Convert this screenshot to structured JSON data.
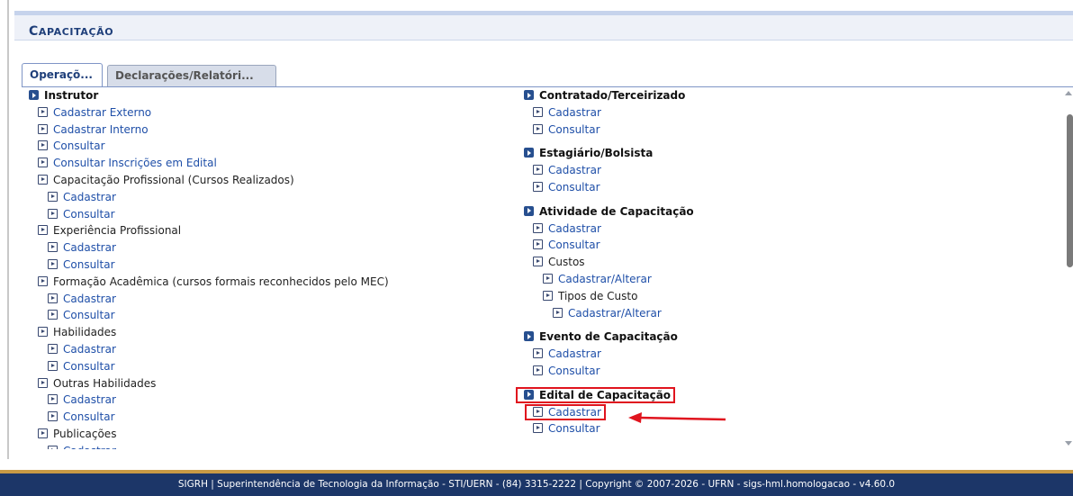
{
  "page": {
    "title_first": "C",
    "title_rest": "apacitação"
  },
  "tabs": [
    {
      "label": "Operaçõ..."
    },
    {
      "label": "Declarações/Relatóri..."
    }
  ],
  "left_menu": [
    {
      "type": "header",
      "level": 0,
      "label": "Instrutor"
    },
    {
      "type": "link",
      "level": 1,
      "label": "Cadastrar Externo"
    },
    {
      "type": "link",
      "level": 1,
      "label": "Cadastrar Interno"
    },
    {
      "type": "link",
      "level": 1,
      "label": "Consultar"
    },
    {
      "type": "link",
      "level": 1,
      "label": "Consultar Inscrições em Edital"
    },
    {
      "type": "plain",
      "level": 1,
      "label": "Capacitação Profissional (Cursos Realizados)"
    },
    {
      "type": "link",
      "level": 2,
      "label": "Cadastrar"
    },
    {
      "type": "link",
      "level": 2,
      "label": "Consultar"
    },
    {
      "type": "plain",
      "level": 1,
      "label": "Experiência Profissional"
    },
    {
      "type": "link",
      "level": 2,
      "label": "Cadastrar"
    },
    {
      "type": "link",
      "level": 2,
      "label": "Consultar"
    },
    {
      "type": "plain",
      "level": 1,
      "label": "Formação Acadêmica (cursos formais reconhecidos pelo MEC)"
    },
    {
      "type": "link",
      "level": 2,
      "label": "Cadastrar"
    },
    {
      "type": "link",
      "level": 2,
      "label": "Consultar"
    },
    {
      "type": "plain",
      "level": 1,
      "label": "Habilidades"
    },
    {
      "type": "link",
      "level": 2,
      "label": "Cadastrar"
    },
    {
      "type": "link",
      "level": 2,
      "label": "Consultar"
    },
    {
      "type": "plain",
      "level": 1,
      "label": "Outras Habilidades"
    },
    {
      "type": "link",
      "level": 2,
      "label": "Cadastrar"
    },
    {
      "type": "link",
      "level": 2,
      "label": "Consultar"
    },
    {
      "type": "plain",
      "level": 1,
      "label": "Publicações"
    },
    {
      "type": "link",
      "level": 2,
      "label": "Cadastrar"
    }
  ],
  "right_menu": [
    {
      "type": "header",
      "level": 0,
      "label": "Contratado/Terceirizado"
    },
    {
      "type": "link",
      "level": 1,
      "label": "Cadastrar"
    },
    {
      "type": "link",
      "level": 1,
      "label": "Consultar"
    },
    {
      "type": "gap"
    },
    {
      "type": "header",
      "level": 0,
      "label": "Estagiário/Bolsista"
    },
    {
      "type": "link",
      "level": 1,
      "label": "Cadastrar"
    },
    {
      "type": "link",
      "level": 1,
      "label": "Consultar"
    },
    {
      "type": "gap"
    },
    {
      "type": "header",
      "level": 0,
      "label": "Atividade de Capacitação"
    },
    {
      "type": "link",
      "level": 1,
      "label": "Cadastrar"
    },
    {
      "type": "link",
      "level": 1,
      "label": "Consultar"
    },
    {
      "type": "plain",
      "level": 1,
      "label": "Custos"
    },
    {
      "type": "link",
      "level": 2,
      "label": "Cadastrar/Alterar"
    },
    {
      "type": "plain",
      "level": 2,
      "label": "Tipos de Custo"
    },
    {
      "type": "link",
      "level": 3,
      "label": "Cadastrar/Alterar"
    },
    {
      "type": "gap"
    },
    {
      "type": "header",
      "level": 0,
      "label": "Evento de Capacitação"
    },
    {
      "type": "link",
      "level": 1,
      "label": "Cadastrar"
    },
    {
      "type": "link",
      "level": 1,
      "label": "Consultar"
    },
    {
      "type": "gap"
    },
    {
      "type": "header",
      "level": 0,
      "label": "Edital de Capacitação",
      "highlight": true
    },
    {
      "type": "link",
      "level": 1,
      "label": "Cadastrar",
      "highlight": true
    },
    {
      "type": "link",
      "level": 1,
      "label": "Consultar"
    }
  ],
  "annotation": {
    "color": "#e0141e"
  },
  "footer": {
    "text": "SIGRH | Superintendência de Tecnologia da Informação - STI/UERN - (84) 3315-2222 | Copyright © 2007-2026 - UFRN - sigs-hml.homologacao - v4.60.0"
  },
  "colors": {
    "link": "#1f4fa8",
    "header_bar": "#1c3668",
    "accent": "#c89a45"
  }
}
